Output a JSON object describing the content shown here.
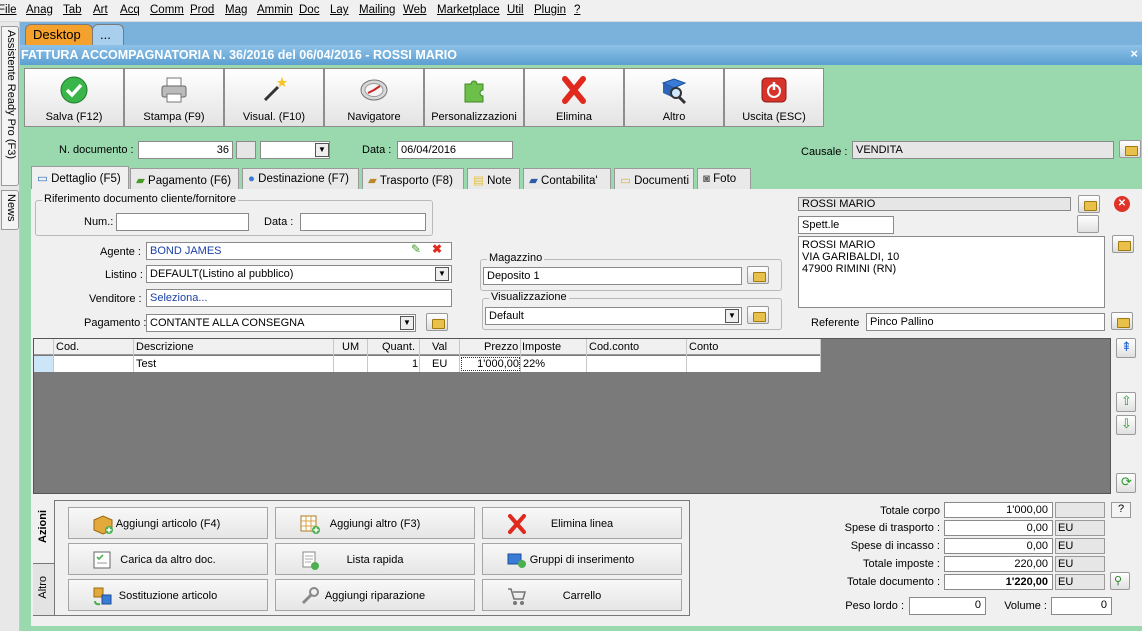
{
  "menu": [
    "File",
    "Anag",
    "Tab",
    "Art",
    "Acq",
    "Comm",
    "Prod",
    "Mag",
    "Ammin",
    "Doc",
    "Lay",
    "Mailing",
    "Web",
    "Marketplace",
    "Util",
    "Plugin",
    "?"
  ],
  "side_tabs": {
    "assistant": "Assistente Ready Pro (F3)",
    "news": "News"
  },
  "tabs": {
    "desktop": "Desktop",
    "more": "..."
  },
  "window_title": "FATTURA ACCOMPAGNATORIA N. 36/2016 del 06/04/2016 - ROSSI MARIO",
  "close_glyph": "×",
  "toolbar": {
    "save": "Salva (F12)",
    "print": "Stampa (F9)",
    "preview": "Visual. (F10)",
    "navigator": "Navigatore",
    "customize": "Personalizzazioni",
    "delete": "Elimina",
    "other": "Altro",
    "exit": "Uscita (ESC)"
  },
  "header": {
    "doc_number_label": "N. documento :",
    "doc_number": "36",
    "date_label": "Data :",
    "date": "06/04/2016",
    "causale_label": "Causale :",
    "causale": "VENDITA"
  },
  "page_tabs": [
    "Dettaglio (F5)",
    "Pagamento (F6)",
    "Destinazione (F7)",
    "Trasporto (F8)",
    "Note",
    "Contabilita'",
    "Documenti",
    "Foto"
  ],
  "reference": {
    "group_title": "Riferimento documento cliente/fornitore",
    "num_label": "Num.:",
    "num": "",
    "date_label": "Data :",
    "date": ""
  },
  "fields": {
    "agent_label": "Agente :",
    "agent": "BOND JAMES",
    "pricelist_label": "Listino :",
    "pricelist": "DEFAULT(Listino al pubblico)",
    "seller_label": "Venditore :",
    "seller": "Seleziona...",
    "payment_label": "Pagamento :",
    "payment": "CONTANTE ALLA CONSEGNA"
  },
  "warehouse": {
    "group_title": "Magazzino",
    "value": "Deposito 1"
  },
  "view": {
    "group_title": "Visualizzazione",
    "value": "Default"
  },
  "customer": {
    "name": "ROSSI MARIO",
    "salutation": "Spett.le",
    "address": [
      "ROSSI MARIO",
      "VIA GARIBALDI, 10",
      "47900 RIMINI (RN)"
    ],
    "referent_label": "Referente",
    "referent": "Pinco Pallino"
  },
  "grid": {
    "headers": [
      "Cod.",
      "Descrizione",
      "UM",
      "Quant.",
      "Val",
      "Prezzo",
      "Imposte",
      "Cod.conto",
      "Conto"
    ],
    "rows": [
      {
        "cod": "",
        "desc": "Test",
        "um": "",
        "qty": "1",
        "val": "EU",
        "price": "1'000,00",
        "tax": "22%",
        "acc_code": "",
        "account": ""
      }
    ]
  },
  "actions": {
    "tab_actions": "Azioni",
    "tab_other": "Altro",
    "add_article": "Aggiungi articolo (F4)",
    "add_other": "Aggiungi altro (F3)",
    "delete_line": "Elimina linea",
    "load_doc": "Carica da altro doc.",
    "quick_list": "Lista rapida",
    "insert_groups": "Gruppi di inserimento",
    "replace_article": "Sostituzione articolo",
    "add_repair": "Aggiungi riparazione",
    "cart": "Carrello"
  },
  "totals": {
    "body_label": "Totale corpo",
    "body": "1'000,00",
    "help": "?",
    "shipping_label": "Spese di trasporto :",
    "shipping": "0,00",
    "collection_label": "Spese di incasso :",
    "collection": "0,00",
    "taxes_label": "Totale imposte :",
    "taxes": "220,00",
    "doc_label": "Totale documento :",
    "doc": "1'220,00",
    "currency": "EU",
    "weight_label": "Peso lordo :",
    "weight": "0",
    "volume_label": "Volume :",
    "volume": "0"
  },
  "colors": {
    "background": "#99d9ad",
    "tabstrip": "#7ab2dc",
    "title": "#5c9fd2",
    "desktop_tab": "#f5a12d"
  }
}
